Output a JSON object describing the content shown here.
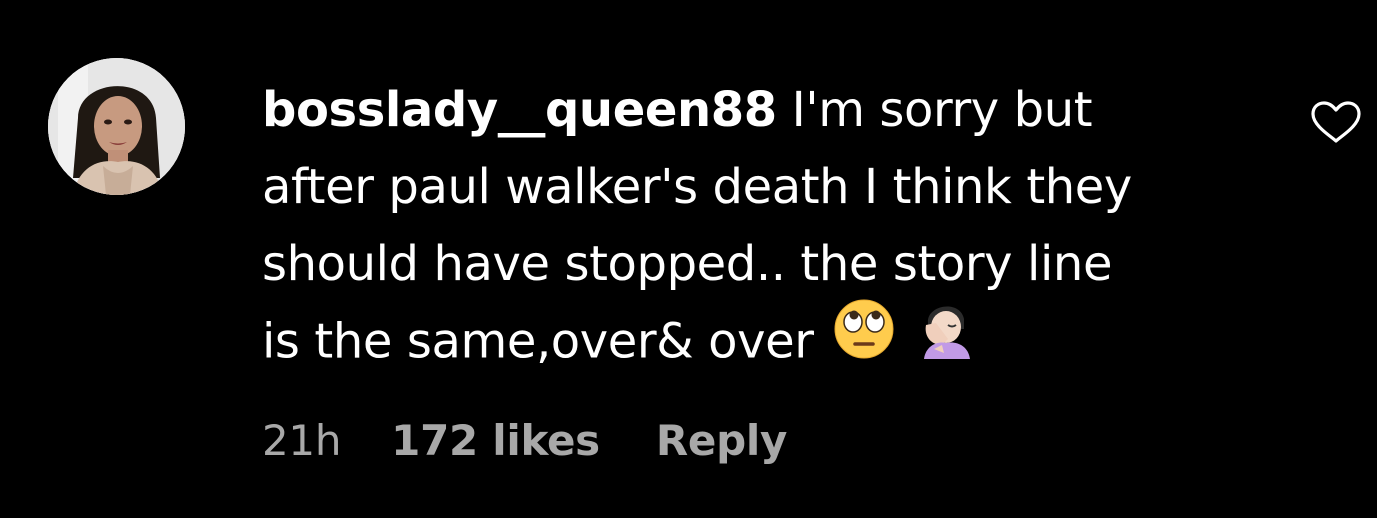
{
  "comment": {
    "username": "bosslady__queen88",
    "lines": [
      "I'm sorry but",
      "after paul walker's death I think they",
      "should have stopped.. the story line",
      "is the same,over& over"
    ],
    "emojis": [
      "🙄",
      "🤦🏻‍♀️"
    ]
  },
  "meta": {
    "time": "21h",
    "likes": "172 likes",
    "reply_label": "Reply"
  },
  "icons": {
    "like": "heart-outline-icon",
    "avatar": "user-avatar"
  },
  "colors": {
    "background": "#000000",
    "text": "#ffffff",
    "secondary_text": "#a8a8a8"
  }
}
